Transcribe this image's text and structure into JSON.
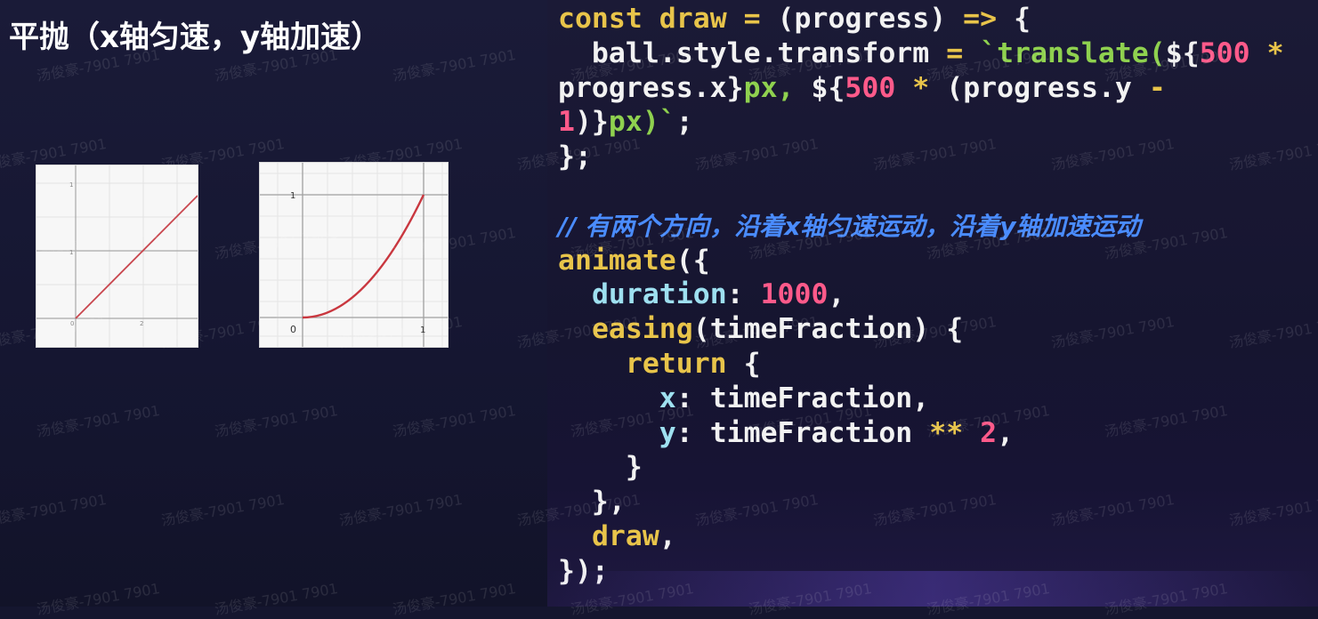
{
  "slide": {
    "title": "平抛（x轴匀速，y轴加速）"
  },
  "graphs": {
    "linear": {
      "label_0": "0",
      "label_1": "1",
      "label_2": "2",
      "label_y": "1"
    },
    "quadratic": {
      "label_origin": "0",
      "label_x1": "1",
      "label_y1": "1"
    }
  },
  "code": {
    "lines": [
      [
        [
          "kw-const",
          "const"
        ],
        [
          "ident",
          " "
        ],
        [
          "fn",
          "draw"
        ],
        [
          "ident",
          " "
        ],
        [
          "op",
          "="
        ],
        [
          "ident",
          " (progress) "
        ],
        [
          "op",
          "=>"
        ],
        [
          "ident",
          " {"
        ]
      ],
      [
        [
          "ident",
          "  ball.style.transform "
        ],
        [
          "op",
          "="
        ],
        [
          "ident",
          " "
        ],
        [
          "str",
          "`translate("
        ],
        [
          "ident",
          "${"
        ],
        [
          "num",
          "500"
        ],
        [
          "ident",
          " "
        ],
        [
          "op",
          "*"
        ]
      ],
      [
        [
          "ident",
          "progress.x}"
        ],
        [
          "str",
          "px, "
        ],
        [
          "ident",
          "${"
        ],
        [
          "num",
          "500"
        ],
        [
          "ident",
          " "
        ],
        [
          "op",
          "*"
        ],
        [
          "ident",
          " (progress.y "
        ],
        [
          "op",
          "-"
        ]
      ],
      [
        [
          "num",
          "1"
        ],
        [
          "ident",
          ")}"
        ],
        [
          "str",
          "px)`"
        ],
        [
          "ident",
          ";"
        ]
      ],
      [
        [
          "ident",
          "};"
        ]
      ],
      [
        [
          "ident",
          ""
        ]
      ],
      [
        [
          "comment",
          "// 有两个方向，沿着x轴匀速运动，沿着y轴加速运动"
        ]
      ],
      [
        [
          "fn",
          "animate"
        ],
        [
          "ident",
          "({"
        ]
      ],
      [
        [
          "ident",
          "  "
        ],
        [
          "prop",
          "duration"
        ],
        [
          "ident",
          ": "
        ],
        [
          "num",
          "1000"
        ],
        [
          "ident",
          ","
        ]
      ],
      [
        [
          "ident",
          "  "
        ],
        [
          "fn",
          "easing"
        ],
        [
          "ident",
          "(timeFraction) {"
        ]
      ],
      [
        [
          "ident",
          "    "
        ],
        [
          "kw-ret",
          "return"
        ],
        [
          "ident",
          " {"
        ]
      ],
      [
        [
          "ident",
          "      "
        ],
        [
          "prop",
          "x"
        ],
        [
          "ident",
          ": timeFraction,"
        ]
      ],
      [
        [
          "ident",
          "      "
        ],
        [
          "prop",
          "y"
        ],
        [
          "ident",
          ": timeFraction "
        ],
        [
          "op",
          "**"
        ],
        [
          "ident",
          " "
        ],
        [
          "num",
          "2"
        ],
        [
          "ident",
          ","
        ]
      ],
      [
        [
          "ident",
          "    }"
        ]
      ],
      [
        [
          "ident",
          "  },"
        ]
      ],
      [
        [
          "ident",
          "  "
        ],
        [
          "fn",
          "draw"
        ],
        [
          "ident",
          ","
        ]
      ],
      [
        [
          "ident",
          "});"
        ]
      ]
    ]
  },
  "watermark": {
    "text": "汤俊豪-7901 7901"
  }
}
